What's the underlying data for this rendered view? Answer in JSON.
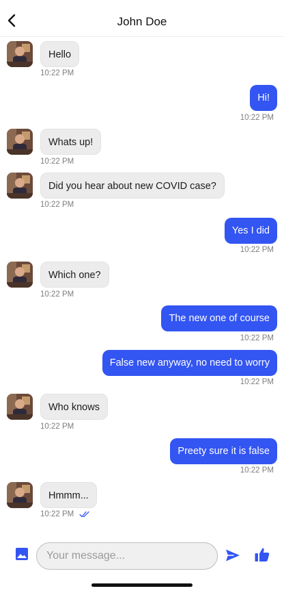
{
  "header": {
    "title": "John Doe",
    "back_icon": "chevron-left-icon"
  },
  "colors": {
    "accent": "#3355f2",
    "incoming_bubble": "#ececec",
    "time_text": "#7d7d7d"
  },
  "messages": [
    {
      "from": "them",
      "text": "Hello",
      "time": "10:22 PM"
    },
    {
      "from": "me",
      "text": "Hi!",
      "time": "10:22 PM"
    },
    {
      "from": "them",
      "text": "Whats up!",
      "time": "10:22 PM"
    },
    {
      "from": "them",
      "text": "Did you hear about new COVID case?",
      "time": "10:22 PM"
    },
    {
      "from": "me",
      "text": "Yes I did",
      "time": "10:22 PM"
    },
    {
      "from": "them",
      "text": "Which one?",
      "time": "10:22 PM"
    },
    {
      "from": "me",
      "text": "The new one of course",
      "time": "10:22 PM"
    },
    {
      "from": "me",
      "text": "False new anyway, no need to worry",
      "time": "10:22 PM"
    },
    {
      "from": "them",
      "text": "Who knows",
      "time": "10:22 PM"
    },
    {
      "from": "me",
      "text": "Preety sure it is false",
      "time": "10:22 PM"
    },
    {
      "from": "them",
      "text": "Hmmm...",
      "time": "10:22 PM",
      "status_icon": "double-check-icon"
    }
  ],
  "composer": {
    "placeholder": "Your message...",
    "value": "",
    "image_icon": "image-icon",
    "send_icon": "send-icon",
    "like_icon": "thumbs-up-icon"
  }
}
